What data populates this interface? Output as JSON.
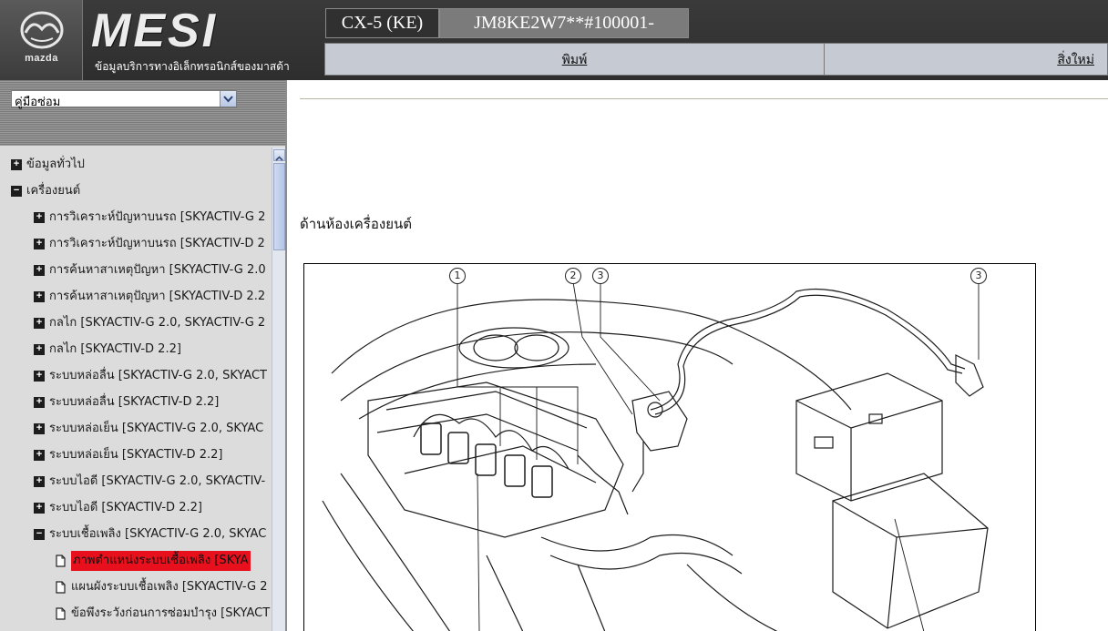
{
  "header": {
    "logo_word": "mazda",
    "brand": "MESI",
    "brand_sub": "ข้อมูลบริการทางอิเล็กทรอนิกส์ของมาสด้า",
    "model": "CX-5 (KE)",
    "vin": "JM8KE2W7**#100001-",
    "print_label": "พิมพ์",
    "new_label": "สิ่งใหม่"
  },
  "sidebar": {
    "dropdown_value": "คู่มือซ่อม",
    "tree": [
      {
        "level": 0,
        "icon": "plus",
        "label": "ข้อมูลทั่วไป"
      },
      {
        "level": 0,
        "icon": "minus",
        "label": "เครื่องยนต์"
      },
      {
        "level": 1,
        "icon": "plus",
        "label": "การวิเคราะห์ปัญหาบนรถ [SKYACTIV-G 2"
      },
      {
        "level": 1,
        "icon": "plus",
        "label": "การวิเคราะห์ปัญหาบนรถ [SKYACTIV-D 2"
      },
      {
        "level": 1,
        "icon": "plus",
        "label": "การค้นหาสาเหตุปัญหา [SKYACTIV-G 2.0"
      },
      {
        "level": 1,
        "icon": "plus",
        "label": "การค้นหาสาเหตุปัญหา [SKYACTIV-D 2.2"
      },
      {
        "level": 1,
        "icon": "plus",
        "label": "กลไก [SKYACTIV-G 2.0, SKYACTIV-G 2"
      },
      {
        "level": 1,
        "icon": "plus",
        "label": "กลไก [SKYACTIV-D 2.2]"
      },
      {
        "level": 1,
        "icon": "plus",
        "label": "ระบบหล่อลื่น [SKYACTIV-G 2.0, SKYACT"
      },
      {
        "level": 1,
        "icon": "plus",
        "label": "ระบบหล่อลื่น [SKYACTIV-D 2.2]"
      },
      {
        "level": 1,
        "icon": "plus",
        "label": "ระบบหล่อเย็น [SKYACTIV-G 2.0, SKYAC"
      },
      {
        "level": 1,
        "icon": "plus",
        "label": "ระบบหล่อเย็น [SKYACTIV-D 2.2]"
      },
      {
        "level": 1,
        "icon": "plus",
        "label": "ระบบไอดี [SKYACTIV-G 2.0, SKYACTIV-"
      },
      {
        "level": 1,
        "icon": "plus",
        "label": "ระบบไอดี [SKYACTIV-D 2.2]"
      },
      {
        "level": 1,
        "icon": "minus",
        "label": "ระบบเชื้อเพลิง [SKYACTIV-G 2.0, SKYAC"
      },
      {
        "level": 2,
        "icon": "doc",
        "label": "ภาพตำแหน่งระบบเชื้อเพลิง [SKYA",
        "selected": true
      },
      {
        "level": 2,
        "icon": "doc",
        "label": "แผนผังระบบเชื้อเพลิง [SKYACTIV-G 2"
      },
      {
        "level": 2,
        "icon": "doc",
        "label": "ข้อพึงระวังก่อนการซ่อมบำรุง [SKYACT"
      }
    ]
  },
  "content": {
    "section_title": "ด้านห้องเครื่องยนต์",
    "callouts": [
      "1",
      "2",
      "3",
      "3"
    ]
  },
  "colors": {
    "header_bg": "#2e2e2e",
    "toolbar_bg": "#c6cad2",
    "sidebar_bg": "#dcdcdc",
    "selected_bg": "#e8101c"
  }
}
